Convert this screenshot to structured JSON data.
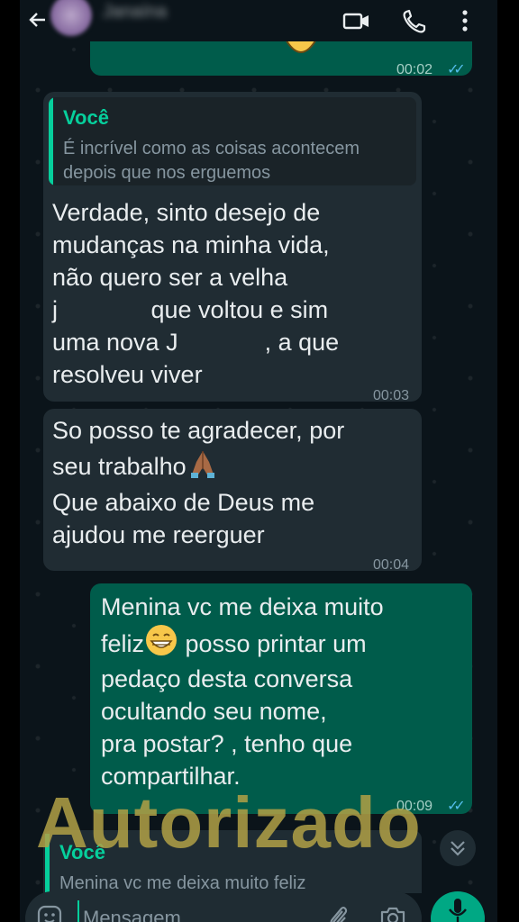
{
  "header": {
    "contact_name": "Janaína",
    "icons": [
      "back-icon",
      "video-icon",
      "call-icon",
      "menu-icon"
    ]
  },
  "messages": [
    {
      "direction": "out",
      "time": "00:02",
      "status": "read"
    },
    {
      "direction": "in",
      "quote_author": "Você",
      "quote_text": "É incrível como as coisas acontecem depois que nos erguemos",
      "line1": "Verdade, sinto desejo de",
      "line2": "mudanças na minha vida,",
      "line3": "não quero ser a velha",
      "line4a": "j",
      "line4b": " que voltou e sim",
      "line5a": "uma nova J",
      "line5b": ", a que",
      "line6": "resolveu viver",
      "time": "00:03"
    },
    {
      "direction": "in",
      "line1": "So posso te agradecer, por",
      "line2": "seu trabalho",
      "line3": "Que abaixo de Deus me",
      "line4": "ajudou me reerguer",
      "time": "00:04"
    },
    {
      "direction": "out",
      "line1": "Menina vc me deixa muito",
      "line2a": "feliz",
      "line2b": " posso printar um",
      "line3": "pedaço desta conversa",
      "line4": "ocultando seu nome,",
      "line5": "pra postar? , tenho que",
      "line6": "compartilhar.",
      "time": "00:09",
      "status": "read"
    }
  ],
  "stamp_text": "Autorizado",
  "reply": {
    "author": "Você",
    "text": "Menina vc me deixa muito feliz"
  },
  "input": {
    "placeholder": "Mensagem"
  },
  "colors": {
    "background": "#0b141a",
    "incoming": "#202c33",
    "outgoing": "#005c4b",
    "accent": "#06cf9c",
    "read_ticks": "#53bdeb",
    "stamp": "#b0a046"
  }
}
